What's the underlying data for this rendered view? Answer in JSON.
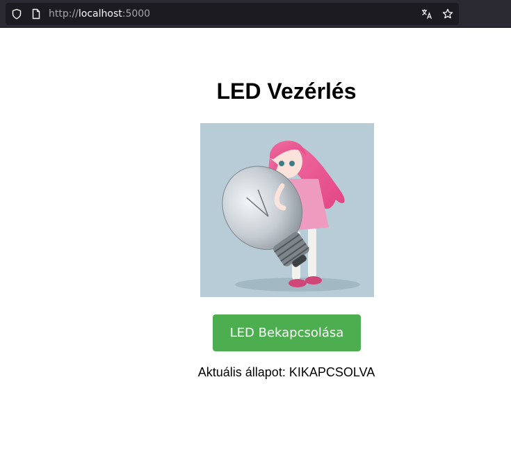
{
  "browser": {
    "url_scheme": "http://",
    "url_host": "localhost",
    "url_port": ":5000"
  },
  "page": {
    "title": "LED Vezérlés",
    "button_label": "LED Bekapcsolása",
    "status_label": "Aktuális állapot:",
    "status_value": "KIKAPCSOLVA"
  },
  "colors": {
    "button_bg": "#4cae4f",
    "chrome_bg": "#2b2a33",
    "urlbar_bg": "#1c1b22"
  },
  "icons": {
    "shield": "shield-icon",
    "page": "page-icon",
    "translate": "translate-icon",
    "bookmark": "star-icon"
  }
}
